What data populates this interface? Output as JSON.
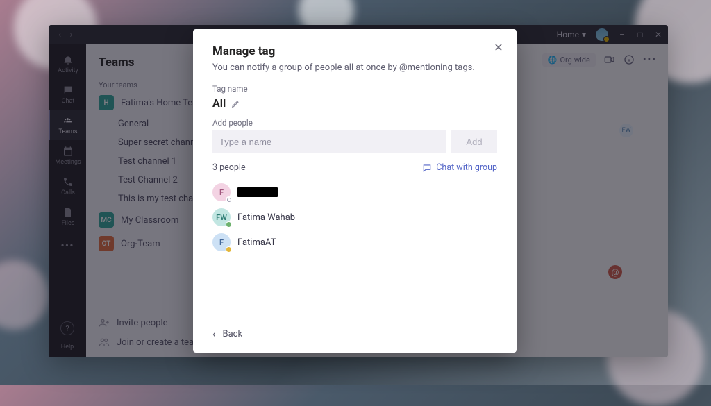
{
  "titlebar": {
    "home_label": "Home"
  },
  "rail": {
    "activity": "Activity",
    "chat": "Chat",
    "teams": "Teams",
    "meetings": "Meetings",
    "calls": "Calls",
    "files": "Files",
    "help": "Help"
  },
  "sidebar": {
    "title": "Teams",
    "your_teams_label": "Your teams",
    "teams": [
      {
        "name": "Fatima's Home Team",
        "badge": "H",
        "badge_color": "tb-green"
      },
      {
        "name": "My Classroom",
        "badge": "MC",
        "badge_color": "tb-teal"
      },
      {
        "name": "Org-Team",
        "badge": "OT",
        "badge_color": "tb-orange"
      }
    ],
    "channels": [
      "General",
      "Super secret channel",
      "Test channel 1",
      "Test Channel 2",
      "This is my test channel"
    ],
    "invite_label": "Invite people",
    "join_label": "Join or create a team"
  },
  "main_header": {
    "org_wide": "Org-wide",
    "mini_avatar": "FW"
  },
  "modal": {
    "title": "Manage tag",
    "description": "You can notify a group of people all at once by @mentioning tags.",
    "tag_name_label": "Tag name",
    "tag_name": "All",
    "add_people_label": "Add people",
    "add_placeholder": "Type a name",
    "add_button": "Add",
    "people_count": "3 people",
    "chat_with_group": "Chat with group",
    "people": [
      {
        "initials": "F",
        "avatar_class": "av-pink",
        "presence": "pres-clock",
        "redacted": true
      },
      {
        "initials": "FW",
        "avatar_class": "av-teal",
        "presence": "pres-green",
        "name": "Fatima Wahab"
      },
      {
        "initials": "F",
        "avatar_class": "av-blue",
        "presence": "pres-yellow",
        "name": "FatimaAT"
      }
    ],
    "back": "Back"
  }
}
